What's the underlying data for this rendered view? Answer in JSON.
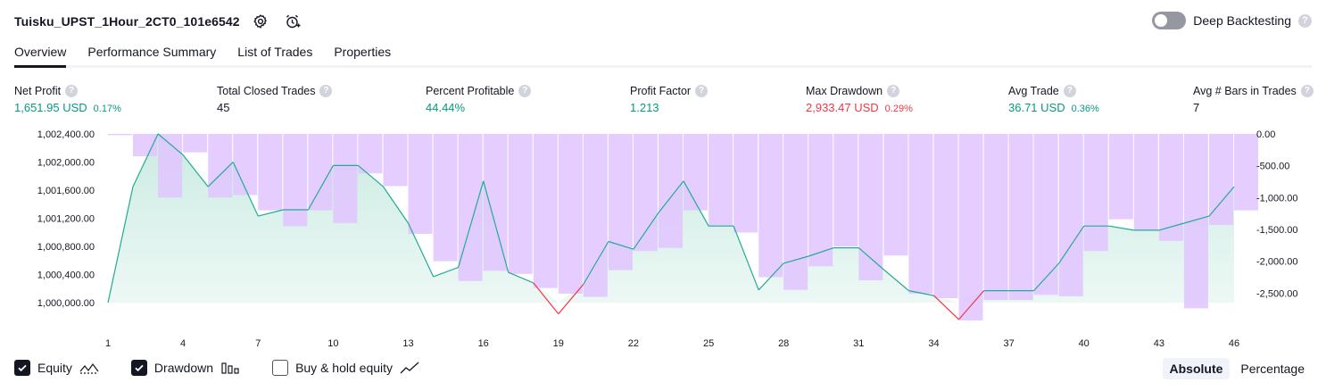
{
  "header": {
    "strategy_name": "Tuisku_UPST_1Hour_2CT0_101e6542",
    "settings_icon": "gear-icon",
    "alert_icon": "alarm-clock-plus-icon",
    "deep_backtesting_label": "Deep Backtesting",
    "deep_backtesting_enabled": false,
    "help_glyph": "?"
  },
  "tabs": [
    {
      "label": "Overview",
      "active": true
    },
    {
      "label": "Performance Summary",
      "active": false
    },
    {
      "label": "List of Trades",
      "active": false
    },
    {
      "label": "Properties",
      "active": false
    }
  ],
  "metrics": [
    {
      "label": "Net Profit",
      "value": "1,651.95 USD",
      "pct": "0.17%",
      "tone": "pos"
    },
    {
      "label": "Total Closed Trades",
      "value": "45",
      "pct": "",
      "tone": "neu"
    },
    {
      "label": "Percent Profitable",
      "value": "44.44%",
      "pct": "",
      "tone": "pos"
    },
    {
      "label": "Profit Factor",
      "value": "1.213",
      "pct": "",
      "tone": "pos"
    },
    {
      "label": "Max Drawdown",
      "value": "2,933.47 USD",
      "pct": "0.29%",
      "tone": "neg"
    },
    {
      "label": "Avg Trade",
      "value": "36.71 USD",
      "pct": "0.36%",
      "tone": "pos"
    },
    {
      "label": "Avg # Bars in Trades",
      "value": "7",
      "pct": "",
      "tone": "neu"
    }
  ],
  "colors": {
    "profit": "#089981",
    "loss": "#f23645",
    "equity_line": "#22ab94",
    "equity_fill": "#d7f0ea",
    "drawdown_bar": "#e1c4ff",
    "text": "#131722"
  },
  "chart_data": {
    "type": "line",
    "x_ticks": [
      "1",
      "4",
      "7",
      "10",
      "13",
      "16",
      "19",
      "22",
      "25",
      "28",
      "31",
      "34",
      "37",
      "40",
      "43",
      "46"
    ],
    "y_left_ticks": [
      "1,002,400.00",
      "1,002,000.00",
      "1,001,600.00",
      "1,001,200.00",
      "1,000,800.00",
      "1,000,400.00",
      "1,000,000.00"
    ],
    "y_left_range": [
      1000000,
      1002400
    ],
    "y_right_ticks": [
      "0.00",
      "-500.00",
      "-1,000.00",
      "-1,500.00",
      "-2,000.00",
      "-2,500.00"
    ],
    "y_right_range": [
      -2650,
      0
    ],
    "x": [
      1,
      2,
      3,
      4,
      5,
      6,
      7,
      8,
      9,
      10,
      11,
      12,
      13,
      14,
      15,
      16,
      17,
      18,
      19,
      20,
      21,
      22,
      23,
      24,
      25,
      26,
      27,
      28,
      29,
      30,
      31,
      32,
      33,
      34,
      35,
      36,
      37,
      38,
      39,
      40,
      41,
      42,
      43,
      44,
      45,
      46
    ],
    "series": [
      {
        "name": "Equity",
        "values": [
          1000000,
          1001650,
          1002400,
          1002100,
          1001650,
          1002000,
          1001230,
          1001320,
          1001320,
          1001950,
          1001950,
          1001650,
          1001130,
          1000370,
          1000500,
          1001730,
          1000430,
          1000280,
          999840,
          1000260,
          1000870,
          1000760,
          1001280,
          1001730,
          1001090,
          1001090,
          1000180,
          1000560,
          1000660,
          1000780,
          1000780,
          1000470,
          1000170,
          1000100,
          999760,
          1000170,
          1000170,
          1000170,
          1000560,
          1001090,
          1001090,
          1001030,
          1001030,
          1001130,
          1001230,
          1001650
        ]
      },
      {
        "name": "Drawdown",
        "values": [
          -20,
          -350,
          -1000,
          -290,
          -1000,
          -960,
          -1200,
          -1450,
          -1200,
          -1400,
          -620,
          -820,
          -1570,
          -2000,
          -2310,
          -2150,
          -2200,
          -2420,
          -2510,
          -2560,
          -2140,
          -1840,
          -1790,
          -1200,
          -1450,
          -1550,
          -2250,
          -2450,
          -2080,
          -1770,
          -2300,
          -1910,
          -2510,
          -2580,
          -2930,
          -2610,
          -2610,
          -2530,
          -2550,
          -1840,
          -1340,
          -1510,
          -1680,
          -2740,
          -1430,
          -1200
        ]
      }
    ]
  },
  "legend": [
    {
      "label": "Equity",
      "checked": true,
      "icon": "equity-line-icon"
    },
    {
      "label": "Drawdown",
      "checked": true,
      "icon": "drawdown-bars-icon"
    },
    {
      "label": "Buy & hold equity",
      "checked": false,
      "icon": "buy-hold-line-icon"
    }
  ],
  "modes": [
    {
      "label": "Absolute",
      "active": true
    },
    {
      "label": "Percentage",
      "active": false
    }
  ]
}
